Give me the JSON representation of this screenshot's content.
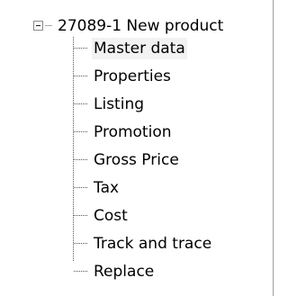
{
  "tree": {
    "root": {
      "label": "27089-1 New product",
      "expanded": true
    },
    "children": [
      {
        "label": "Master data",
        "selected": true
      },
      {
        "label": "Properties"
      },
      {
        "label": "Listing"
      },
      {
        "label": "Promotion"
      },
      {
        "label": "Gross Price"
      },
      {
        "label": "Tax"
      },
      {
        "label": "Cost"
      },
      {
        "label": "Track and trace"
      },
      {
        "label": "Replace"
      }
    ]
  }
}
